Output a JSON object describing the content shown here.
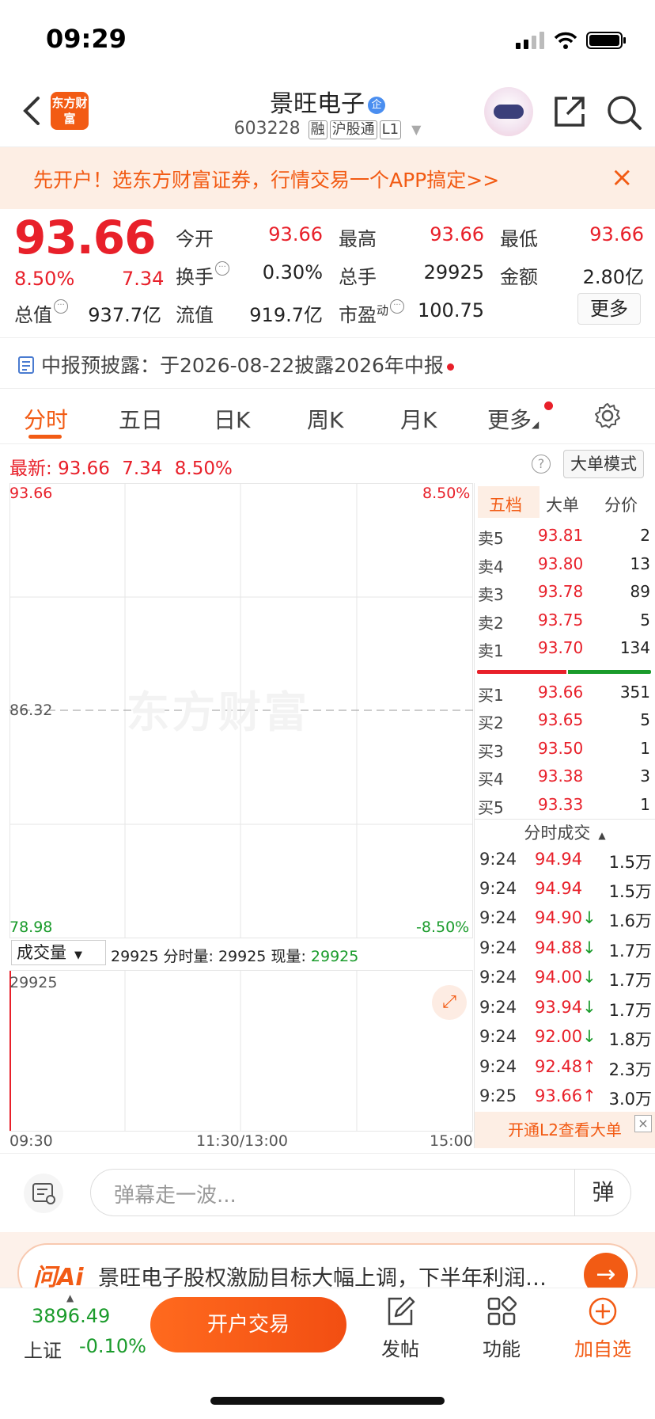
{
  "status_bar": {
    "time": "09:29"
  },
  "header": {
    "logo_text": "东方财富",
    "stock_name": "景旺电子",
    "name_badge": "企",
    "code": "603228",
    "tags": [
      "融",
      "沪股通",
      "L1"
    ]
  },
  "banner": {
    "text": "先开户！选东方财富证券，行情交易一个APP搞定>>"
  },
  "quote": {
    "price": "93.66",
    "change_pct": "8.50%",
    "change": "7.34",
    "fields": {
      "open_label": "今开",
      "open": "93.66",
      "high_label": "最高",
      "high": "93.66",
      "low_label": "最低",
      "low": "93.66",
      "turnover_label": "换手",
      "turnover": "0.30%",
      "volume_label": "总手",
      "volume": "29925",
      "amount_label": "金额",
      "amount": "2.80亿",
      "mktcap_label": "总值",
      "mktcap": "937.7亿",
      "float_label": "流值",
      "float": "919.7亿",
      "pe_label": "市盈",
      "pe_sup": "动",
      "pe": "100.75"
    },
    "more_label": "更多"
  },
  "notice": {
    "text": "中报预披露：于2026-08-22披露2026年中报"
  },
  "tabs": [
    "分时",
    "五日",
    "日K",
    "周K",
    "月K",
    "更多"
  ],
  "latest": {
    "label": "最新:",
    "price": "93.66",
    "change": "7.34",
    "pct": "8.50%"
  },
  "big_order_mode": "大单模式",
  "chart": {
    "y_top": "93.66",
    "y_mid": "86.32",
    "y_bottom": "78.98",
    "pct_top": "8.50%",
    "pct_bottom": "-8.50%",
    "watermark": "东方财富",
    "volume_selector": "成交量",
    "volume_info_value": "29925",
    "volume_info_label1": "分时量:",
    "volume_info_value1": "29925",
    "volume_info_label2": "现量:",
    "volume_info_value2": "29925",
    "volume_axis_max": "29925",
    "x_labels": [
      "09:30",
      "11:30/13:00",
      "15:00"
    ]
  },
  "orderbook": {
    "tabs": [
      "五档",
      "大单",
      "分价"
    ],
    "asks": [
      {
        "label": "卖5",
        "price": "93.81",
        "vol": "2"
      },
      {
        "label": "卖4",
        "price": "93.80",
        "vol": "13"
      },
      {
        "label": "卖3",
        "price": "93.78",
        "vol": "89"
      },
      {
        "label": "卖2",
        "price": "93.75",
        "vol": "5"
      },
      {
        "label": "卖1",
        "price": "93.70",
        "vol": "134"
      }
    ],
    "bids": [
      {
        "label": "买1",
        "price": "93.66",
        "vol": "351"
      },
      {
        "label": "买2",
        "price": "93.65",
        "vol": "5"
      },
      {
        "label": "买3",
        "price": "93.50",
        "vol": "1"
      },
      {
        "label": "买4",
        "price": "93.38",
        "vol": "3"
      },
      {
        "label": "买5",
        "price": "93.33",
        "vol": "1"
      }
    ],
    "buy_sell_ratio": 0.52,
    "ticks_title": "分时成交",
    "ticks": [
      {
        "time": "9:24",
        "price": "94.94",
        "arrow": "",
        "vol": "1.5万"
      },
      {
        "time": "9:24",
        "price": "94.94",
        "arrow": "",
        "vol": "1.5万"
      },
      {
        "time": "9:24",
        "price": "94.90",
        "arrow": "↓",
        "vol": "1.6万"
      },
      {
        "time": "9:24",
        "price": "94.88",
        "arrow": "↓",
        "vol": "1.7万"
      },
      {
        "time": "9:24",
        "price": "94.00",
        "arrow": "↓",
        "vol": "1.7万"
      },
      {
        "time": "9:24",
        "price": "93.94",
        "arrow": "↓",
        "vol": "1.7万"
      },
      {
        "time": "9:24",
        "price": "92.00",
        "arrow": "↓",
        "vol": "1.8万"
      },
      {
        "time": "9:24",
        "price": "92.48",
        "arrow": "↑",
        "vol": "2.3万"
      },
      {
        "time": "9:25",
        "price": "93.66",
        "arrow": "↑",
        "vol": "3.0万"
      }
    ],
    "l2_promo": "开通L2查看大单"
  },
  "danmaku": {
    "placeholder": "弹幕走一波...",
    "button": "弹"
  },
  "ai": {
    "logo": "问Ai",
    "text": "景旺电子股权激励目标大幅上调，下半年利润…"
  },
  "bottom": {
    "index_value": "3896.49",
    "index_name": "上证",
    "index_change": "-0.10%",
    "trade_button": "开户交易",
    "post": "发帖",
    "functions": "功能",
    "add_watch": "加自选"
  },
  "colors": {
    "up": "#e8202a",
    "down": "#1a9b2b",
    "accent": "#f25b14"
  }
}
